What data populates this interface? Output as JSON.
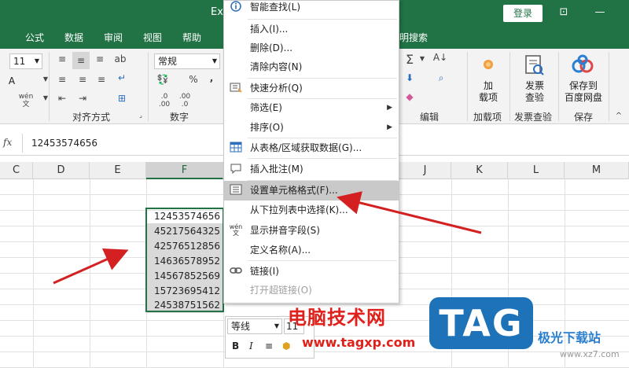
{
  "window": {
    "title": "Exc",
    "login": "登录"
  },
  "tabs": [
    "公式",
    "数据",
    "审阅",
    "视图",
    "帮助",
    "明搜索"
  ],
  "ribbon": {
    "font_size": "11",
    "number_format": "常规",
    "groups": {
      "alignment": "对齐方式",
      "number": "数字",
      "editing": "编辑",
      "addins": "加载项",
      "invoice": "发票查验",
      "save": "保存"
    },
    "big_buttons": {
      "addins": [
        "加",
        "载项"
      ],
      "invoice": [
        "发票",
        "查验"
      ],
      "save": [
        "保存到",
        "百度网盘"
      ]
    },
    "pinyin_icon": "wén",
    "percent": "%",
    "comma": ","
  },
  "formula_bar": {
    "fx": "fx",
    "value": "12453574656"
  },
  "columns": [
    "C",
    "D",
    "E",
    "F",
    "J",
    "K",
    "L",
    "M"
  ],
  "cells": [
    "12453574656",
    "45217564325",
    "42576512856",
    "14636578952",
    "14567852569",
    "15723695412",
    "24538751562"
  ],
  "context_menu": {
    "items": [
      {
        "label": "智能查找(L)",
        "icon": "info-icon"
      },
      {
        "label": "插入(I)..."
      },
      {
        "label": "删除(D)..."
      },
      {
        "label": "清除内容(N)"
      },
      {
        "label": "快速分析(Q)",
        "icon": "quick-analysis-icon"
      },
      {
        "label": "筛选(E)",
        "submenu": true
      },
      {
        "label": "排序(O)",
        "submenu": true
      },
      {
        "label": "从表格/区域获取数据(G)...",
        "icon": "table-icon"
      },
      {
        "label": "插入批注(M)",
        "icon": "comment-icon"
      },
      {
        "label": "设置单元格格式(F)...",
        "icon": "format-cells-icon",
        "highlighted": true
      },
      {
        "label": "从下拉列表中选择(K)..."
      },
      {
        "label": "显示拼音字段(S)",
        "icon": "pinyin-icon"
      },
      {
        "label": "定义名称(A)..."
      },
      {
        "label": "链接(I)",
        "icon": "link-icon"
      },
      {
        "label": "打开超链接(O)",
        "disabled": true
      }
    ]
  },
  "mini_toolbar": {
    "font": "等线",
    "size": "11",
    "bold": "B",
    "italic": "I"
  },
  "overlay": {
    "watermark_text": "电脑技术网",
    "watermark_url": "www.tagxp.com",
    "tag_logo": "TAG",
    "site_name": "极光下载站",
    "site_url": "www.xz7.com",
    "arrow_color": "#d42020"
  }
}
